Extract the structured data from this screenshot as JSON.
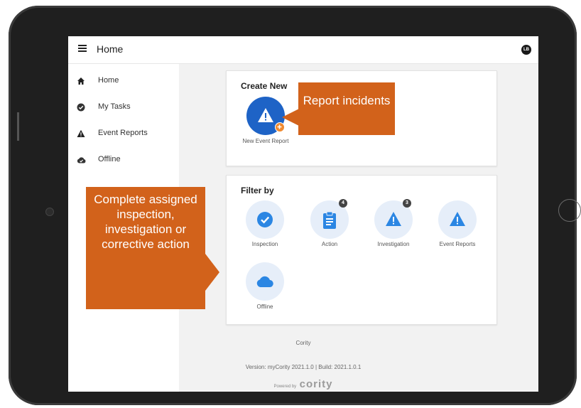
{
  "topbar": {
    "title": "Home",
    "avatar_initials": "LB"
  },
  "sidebar": {
    "items": [
      {
        "label": "Home",
        "icon": "home-icon"
      },
      {
        "label": "My Tasks",
        "icon": "check-circle-icon"
      },
      {
        "label": "Event Reports",
        "icon": "warning-icon"
      },
      {
        "label": "Offline",
        "icon": "cloud-check-icon"
      }
    ]
  },
  "create_new": {
    "title": "Create New",
    "tile_label": "New Event Report",
    "icon": "warning-icon",
    "add_badge_icon": "plus-icon"
  },
  "filter_by": {
    "title": "Filter by",
    "tiles": [
      {
        "label": "Inspection",
        "icon": "check-circle-icon",
        "badge": ""
      },
      {
        "label": "Action",
        "icon": "clipboard-icon",
        "badge": "4"
      },
      {
        "label": "Investigation",
        "icon": "warning-icon",
        "badge": "3"
      },
      {
        "label": "Event Reports",
        "icon": "warning-icon",
        "badge": ""
      },
      {
        "label": "Offline",
        "icon": "cloud-icon",
        "badge": ""
      }
    ]
  },
  "footer": {
    "company": "Cority",
    "version": "Version: myCority 2021.1.0 | Build: 2021.1.0.1",
    "powered_by": "Powered by",
    "brand": "cority"
  },
  "callouts": {
    "report": "Report incidents",
    "complete": "Complete assigned inspection, investigation or corrective action"
  },
  "colors": {
    "primary_blue": "#1e63c6",
    "tile_bg": "#e6eef9",
    "callout": "#d2621b",
    "add_badge": "#f0892e",
    "device_frame": "#1f1f1f"
  }
}
